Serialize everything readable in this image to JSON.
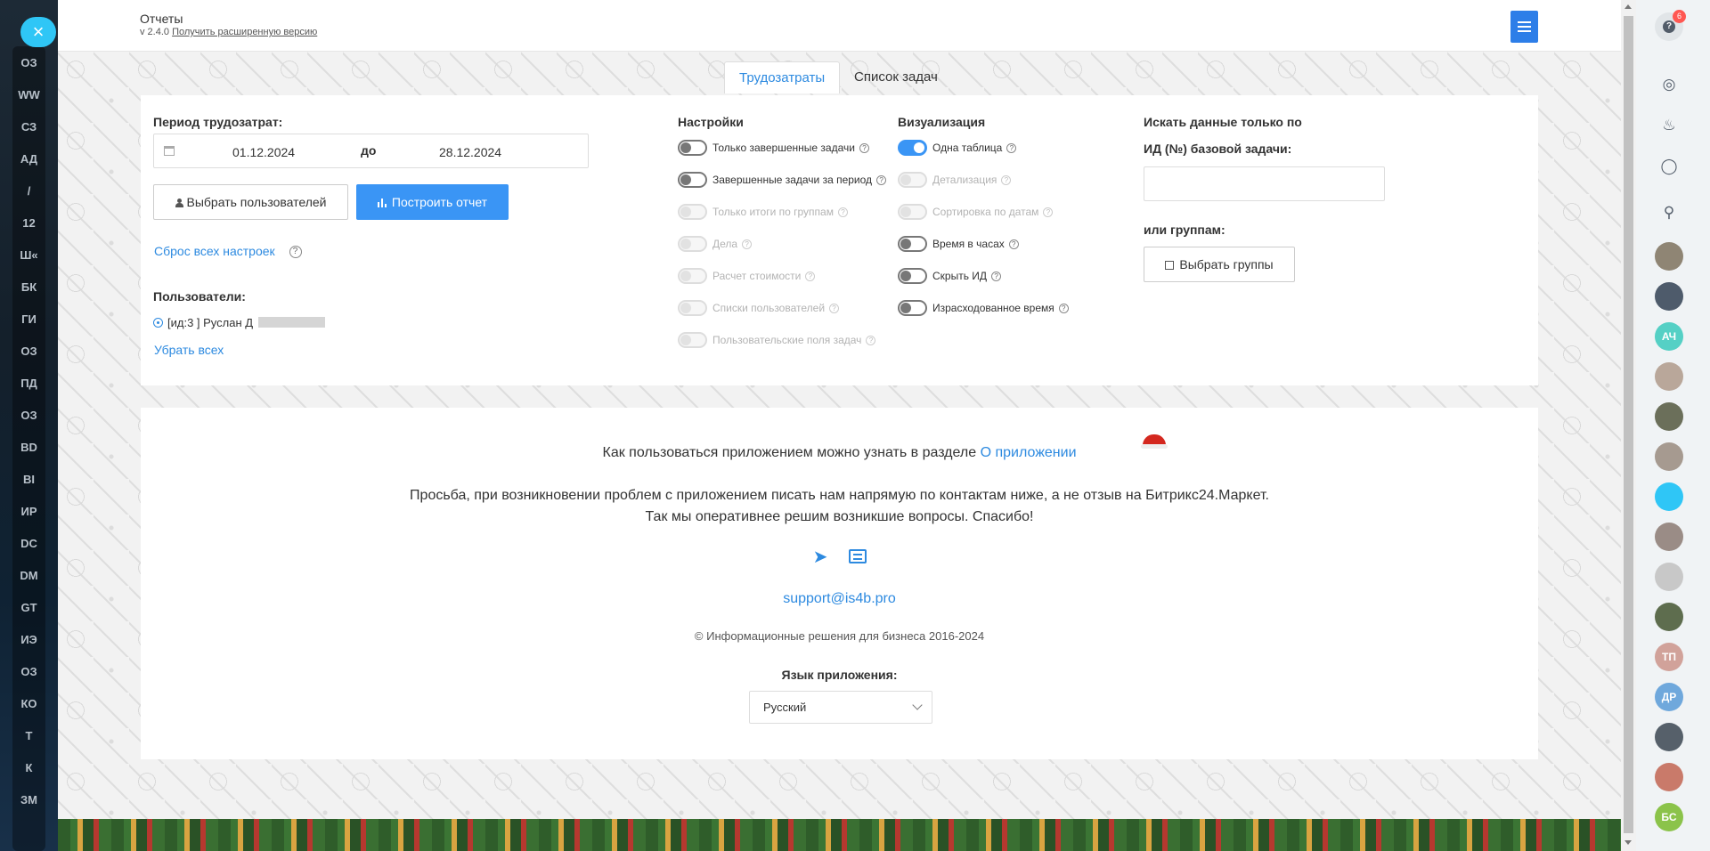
{
  "left_sidebar": {
    "items": [
      "ОЗ",
      "WW",
      "СЗ",
      "АД",
      "/",
      "12",
      "Ш«",
      "БК",
      "ГИ",
      "ОЗ",
      "ПД",
      "ОЗ",
      "BD",
      "BI",
      "ИР",
      "DC",
      "DM",
      "GT",
      "ИЭ",
      "ОЗ",
      "КО",
      "Т",
      "К",
      "ЗМ"
    ],
    "active_index": 11,
    "close_icon": "×"
  },
  "header": {
    "title": "Отчеты",
    "version": "v 2.4.0",
    "upgrade_link": "Получить расширенную версию"
  },
  "tabs": [
    {
      "label": "Трудозатраты",
      "active": true
    },
    {
      "label": "Список задач",
      "active": false
    }
  ],
  "settings": {
    "period_label": "Период трудозатрат:",
    "date_from": "01.12.2024",
    "date_to_label": "до",
    "date_to": "28.12.2024",
    "select_users_button": "Выбрать пользователей",
    "build_report_button": "Построить отчет",
    "reset_link": "Сброс всех настроек",
    "users_label": "Пользователи:",
    "user_entry": "[ид:3   ] Руслан Д",
    "remove_all_link": "Убрать всех",
    "nastroyki": {
      "title": "Настройки",
      "options": [
        {
          "label": "Только завершенные задачи",
          "state": "off",
          "enabled": true
        },
        {
          "label": "Завершенные задачи за период",
          "state": "off",
          "enabled": true
        },
        {
          "label": "Только итоги по группам",
          "state": "off",
          "enabled": false
        },
        {
          "label": "Дела",
          "state": "off",
          "enabled": false
        },
        {
          "label": "Расчет стоимости",
          "state": "off",
          "enabled": false
        },
        {
          "label": "Списки пользователей",
          "state": "off",
          "enabled": false
        },
        {
          "label": "Пользовательские поля задач",
          "state": "off",
          "enabled": false
        }
      ]
    },
    "visualization": {
      "title": "Визуализация",
      "options": [
        {
          "label": "Одна таблица",
          "state": "on",
          "enabled": true
        },
        {
          "label": "Детализация",
          "state": "off",
          "enabled": false
        },
        {
          "label": "Сортировка по датам",
          "state": "off",
          "enabled": false
        },
        {
          "label": "Время в часах",
          "state": "off",
          "enabled": true
        },
        {
          "label": "Скрыть ИД",
          "state": "off",
          "enabled": true
        },
        {
          "label": "Израсходованное время",
          "state": "off",
          "enabled": true
        }
      ]
    },
    "search": {
      "title": "Искать данные только по",
      "base_task_label": "ИД (№) базовой задачи:",
      "base_task_value": "",
      "groups_label": "или группам:",
      "select_groups_button": "Выбрать группы"
    }
  },
  "info": {
    "how_to_text": "Как пользоваться приложением можно узнать в разделе",
    "about_link": "О приложении",
    "request_line1": "Просьба, при возникновении проблем с приложением писать нам напрямую по контактам ниже, а не отзыв на Битрикс24.Маркет.",
    "request_line2": "Так мы оперативнее решим возникшие вопросы. Спасибо!",
    "email": "support@is4b.pro",
    "copyright": "© Информационные решения для бизнеса 2016-2024",
    "language_label": "Язык приложения:",
    "language_value": "Русский"
  },
  "right_panel": {
    "help_badge": "6",
    "avatars": [
      {
        "initials": "",
        "color": "#8f8574"
      },
      {
        "initials": "",
        "color": "#4e5b6b"
      },
      {
        "initials": "АЧ",
        "color": "#55d0c5"
      },
      {
        "initials": "",
        "color": "#b9a79a"
      },
      {
        "initials": "",
        "color": "#6b6f5a"
      },
      {
        "initials": "",
        "color": "#a69a90"
      },
      {
        "initials": "",
        "color": "#2fc6f6"
      },
      {
        "initials": "",
        "color": "#9a8c86"
      },
      {
        "initials": "",
        "color": "#c8c8c8"
      },
      {
        "initials": "",
        "color": "#5e6d4e"
      },
      {
        "initials": "ТП",
        "color": "#d1a29a"
      },
      {
        "initials": "ДР",
        "color": "#6fa8dc"
      },
      {
        "initials": "",
        "color": "#56606a"
      },
      {
        "initials": "",
        "color": "#c97a6a"
      },
      {
        "initials": "БС",
        "color": "#8bc34a"
      }
    ]
  },
  "colors": {
    "accent": "#2d8ae0",
    "primary_button": "#3a95f5",
    "sidebar_close": "#2fc6f6"
  }
}
